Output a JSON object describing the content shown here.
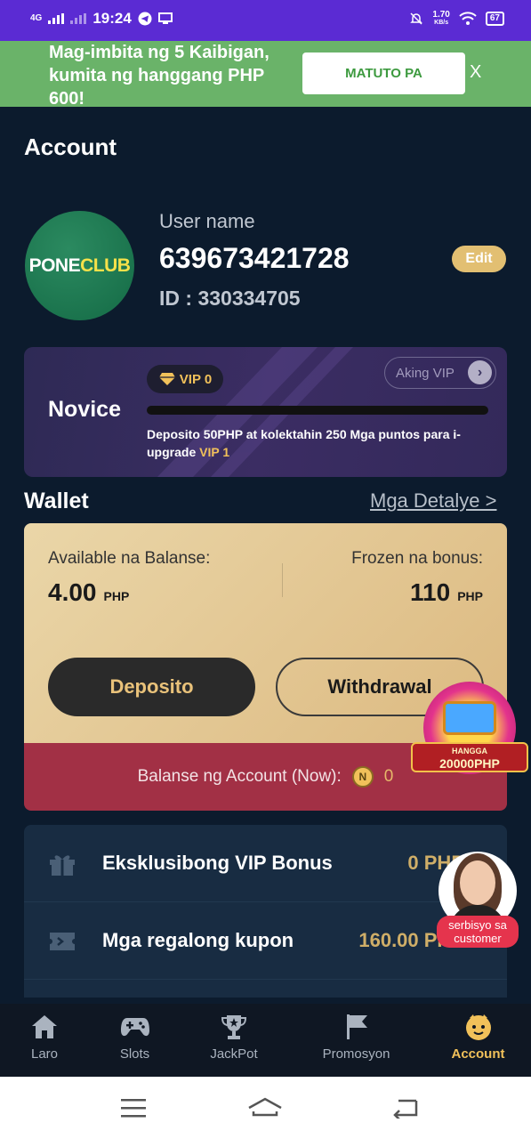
{
  "status_bar": {
    "network": "4G",
    "time": "19:24",
    "speed": "1.70",
    "speed_unit": "KB/s",
    "battery": "67"
  },
  "promo": {
    "text": "Mag-imbita ng 5 Kaibigan, kumita ng hanggang PHP 600!",
    "button": "MATUTO PA",
    "close": "X"
  },
  "page_title": "Account",
  "profile": {
    "avatar_brand_a": "PONE",
    "avatar_brand_b": "CLUB",
    "username_label": "User name",
    "username": "639673421728",
    "id": "ID : 330334705",
    "edit_label": "Edit"
  },
  "vip": {
    "level_name": "Novice",
    "badge": "VIP 0",
    "link": "Aking VIP",
    "progress": 0,
    "desc_main": "Deposito 50PHP at kolektahin 250 Mga puntos para i-upgrade ",
    "desc_target": "VIP 1"
  },
  "wallet": {
    "title": "Wallet",
    "details_link": "Mga Detalye >",
    "available_label": "Available na Balanse:",
    "available_value": "4.00",
    "currency": "PHP",
    "frozen_label": "Frozen na bonus:",
    "frozen_value": "110",
    "deposit_label": "Deposito",
    "withdraw_label": "Withdrawal",
    "account_balance_label": "Balanse ng Account (Now):",
    "coin_symbol": "N",
    "account_balance_value": "0"
  },
  "list": [
    {
      "label": "Eksklusibong VIP Bonus",
      "value": "0 PHP",
      "icon": "gift-icon"
    },
    {
      "label": "Mga regalong kupon",
      "value": "160.00 PHP",
      "icon": "ticket-icon"
    }
  ],
  "floating": {
    "gift_top": "HANGGA",
    "gift_amount": "20000PHP",
    "customer_service": "serbisyo sa customer"
  },
  "nav": [
    {
      "label": "Laro",
      "icon": "home-icon"
    },
    {
      "label": "Slots",
      "icon": "gamepad-icon"
    },
    {
      "label": "JackPot",
      "icon": "trophy-icon"
    },
    {
      "label": "Promosyon",
      "icon": "flag-icon"
    },
    {
      "label": "Account",
      "icon": "smiley-icon",
      "active": true
    }
  ],
  "colors": {
    "background": "#0c1b2d",
    "accent_gold": "#f1c15a",
    "promo_green": "#6ab369",
    "balance_red": "#a23045"
  }
}
